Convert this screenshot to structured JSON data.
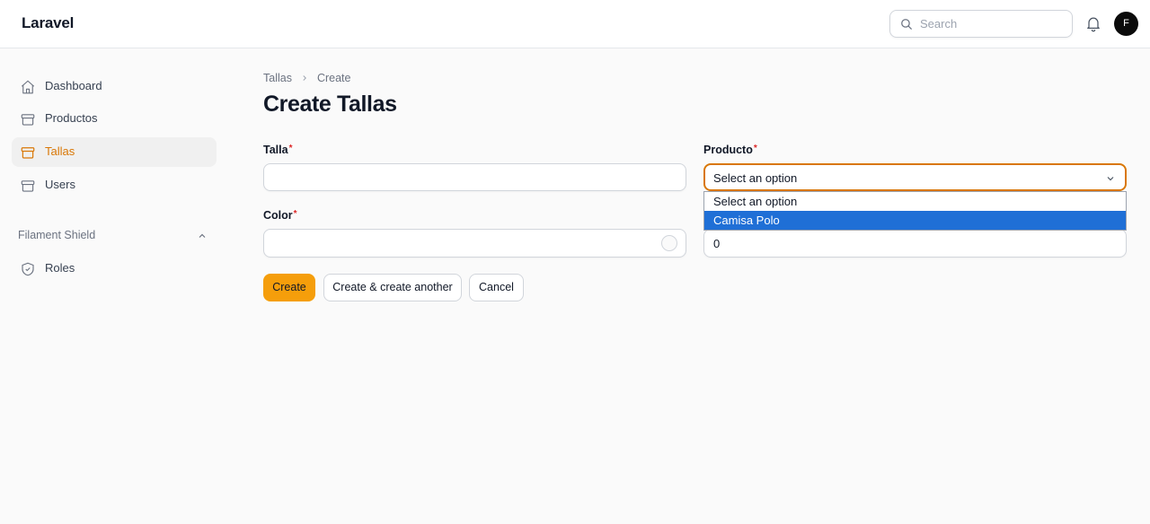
{
  "header": {
    "brand": "Laravel",
    "search_placeholder": "Search",
    "avatar_initial": "F"
  },
  "sidebar": {
    "items": [
      {
        "label": "Dashboard",
        "icon": "home-icon"
      },
      {
        "label": "Productos",
        "icon": "archive-icon"
      },
      {
        "label": "Tallas",
        "icon": "archive-icon",
        "active": true
      },
      {
        "label": "Users",
        "icon": "archive-icon"
      }
    ],
    "group_label": "Filament Shield",
    "group_items": [
      {
        "label": "Roles",
        "icon": "shield-check-icon"
      }
    ]
  },
  "breadcrumb": {
    "parent": "Tallas",
    "current": "Create"
  },
  "page_title": "Create Tallas",
  "form": {
    "talla": {
      "label": "Talla",
      "required": "*",
      "value": ""
    },
    "producto": {
      "label": "Producto",
      "required": "*",
      "selected": "Select an option",
      "options": [
        "Select an option",
        "Camisa Polo"
      ],
      "highlighted_option": "Camisa Polo"
    },
    "color": {
      "label": "Color",
      "required": "*",
      "value": ""
    },
    "numeric_value": "0"
  },
  "actions": {
    "create": "Create",
    "create_another": "Create & create another",
    "cancel": "Cancel"
  },
  "colors": {
    "accent": "#d97706",
    "primary_button": "#f59e0b",
    "dropdown_highlight": "#1f6fd6"
  }
}
